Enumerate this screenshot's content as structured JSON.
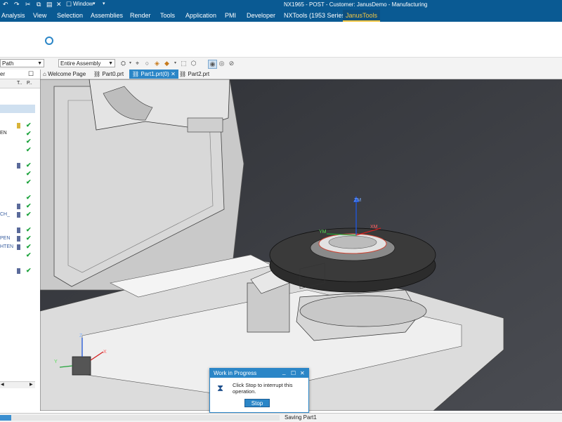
{
  "window": {
    "title": "NX1965 - POST - Customer: JanusDemo - Manufacturing",
    "window_menu_label": "Window"
  },
  "menu": {
    "items": [
      {
        "label": "Analysis"
      },
      {
        "label": "View"
      },
      {
        "label": "Selection"
      },
      {
        "label": "Assemblies"
      },
      {
        "label": "Render"
      },
      {
        "label": "Tools"
      },
      {
        "label": "Application"
      },
      {
        "label": "PMI"
      },
      {
        "label": "Developer"
      },
      {
        "label": "NXTools (1953 Series)"
      },
      {
        "label": "JanusTools"
      }
    ],
    "active": "JanusTools"
  },
  "toolbar": {
    "filter_combo": "Path",
    "assembly_combo": "Entire Assembly"
  },
  "tabs": [
    {
      "label": "Welcome Page"
    },
    {
      "label": "Part0.prt"
    },
    {
      "label": "Part1.prt(0)",
      "close": "✕"
    },
    {
      "label": "Part2.prt"
    }
  ],
  "navigator": {
    "header": "er",
    "col_t": "T..",
    "col_p": "P..",
    "row_labels": [
      "EN",
      "CH_",
      "PEN",
      "HTEN"
    ]
  },
  "viewport": {
    "axis_labels": {
      "z": "ZM",
      "x": "XM",
      "y": "YM",
      "triad_z": "Z",
      "triad_x": "X",
      "triad_y": "Y"
    }
  },
  "dialog": {
    "title": "Work in Progress",
    "message": "Click Stop to interrupt this operation.",
    "stop_label": "Stop",
    "minimize": "_",
    "maximize": "☐",
    "close": "✕"
  },
  "status": {
    "text": "Saving Part1",
    "progress": 0.04
  },
  "colors": {
    "titlebar": "#0a5a93",
    "accent": "#2b86c7",
    "active_tab_text": "#f2c744",
    "check": "#1aa23a"
  }
}
